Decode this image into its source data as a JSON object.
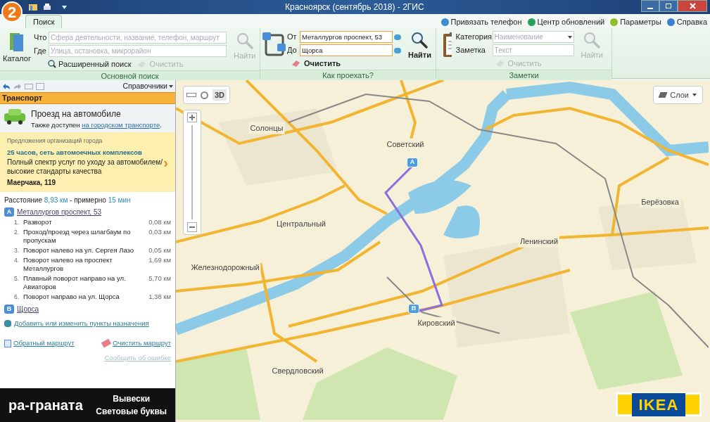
{
  "window": {
    "logo": "2",
    "title": "Красноярск (сентябрь 2018) - 2ГИС"
  },
  "tabs": [
    {
      "label": "Поиск",
      "selected": true
    }
  ],
  "top_links": [
    "Привязать телефон",
    "Центр обновлений",
    "Параметры",
    "Справка"
  ],
  "search_group": {
    "catalog": "Каталог",
    "what_label": "Что",
    "what_placeholder": "Сфера деятельности, название, телефон, маршрут",
    "where_label": "Где",
    "where_placeholder": "Улица, остановка, микрорайон",
    "advanced": "Расширенный поиск",
    "clear": {
      "label": "Очистить",
      "disabled": true
    },
    "find": {
      "label": "Найти",
      "disabled": true
    },
    "title": "Основной поиск"
  },
  "route_group": {
    "from_label": "От",
    "from_value": "Металлургов проспект, 53",
    "to_label": "До",
    "to_value": "Щорса",
    "clear": {
      "label": "Очистить",
      "disabled": false
    },
    "find": {
      "label": "Найти",
      "disabled": false
    },
    "title": "Как проехать?"
  },
  "notes_group": {
    "category_label": "Категория",
    "category_placeholder": "Наименование",
    "note_label": "Заметка",
    "note_placeholder": "Текст",
    "clear": {
      "label": "Очистить",
      "disabled": true
    },
    "find": {
      "label": "Найти",
      "disabled": true
    },
    "title": "Заметки"
  },
  "sidebar": {
    "menu": "Справочники",
    "section": "Транспорт",
    "mode_title": "Проезд на автомобиле",
    "mode_note": "Также доступен ",
    "mode_link": "на городском транспорте",
    "mode_note_end": ".",
    "promo": {
      "heading": "Предложения организаций города",
      "title": "25 часов, сеть автомоечных комплексов",
      "text": "Полный спектр услуг по уходу за автомобилем/высокие стандарты качества",
      "address": "Маерчака, 119",
      "arrow": "›"
    },
    "summary": {
      "label": "Расстояние",
      "distance": "8,93 км",
      "sep": "- примерно",
      "time": "15 мин"
    },
    "start": {
      "marker": "A",
      "name": "Металлургов проспект, 53"
    },
    "steps": [
      {
        "number": "1.",
        "text": "Разворот",
        "distance": "0,08 км"
      },
      {
        "number": "2.",
        "text": "Проход/проезд через шлагбаум по пропускам",
        "distance": "0,03 км"
      },
      {
        "number": "3.",
        "text": "Поворот налево на ул. Сергея Лазо",
        "distance": "0,05 км"
      },
      {
        "number": "4.",
        "text": "Поворот налево на проспект Металлургов",
        "distance": "1,69 км"
      },
      {
        "number": "5.",
        "text": "Плавный поворот направо на ул. Авиаторов",
        "distance": "5,70 км"
      },
      {
        "number": "6.",
        "text": "Поворот направо на ул. Щорса",
        "distance": "1,38 км"
      }
    ],
    "end": {
      "marker": "B",
      "name": "Щорса"
    },
    "add_link": "Добавить или изменить пункты назначения",
    "reverse_link": "Обратный маршрут",
    "clear_link": "Очистить маршрут",
    "report_link": {
      "label": "Сообщить об ошибке",
      "disabled": true
    }
  },
  "ad": {
    "logo": "ра-граната",
    "lines": [
      "Вывески",
      "Световые буквы"
    ]
  },
  "map": {
    "view_3d": "3D",
    "layers": "Слои",
    "labels": [
      "Солонцы",
      "Советский",
      "Центральный",
      "Железнодорожный",
      "Ленинский",
      "Берёзовка",
      "Кировский",
      "Свердловский"
    ],
    "pin_a": "A",
    "pin_b": "B",
    "ad_logo": "IKEA"
  }
}
